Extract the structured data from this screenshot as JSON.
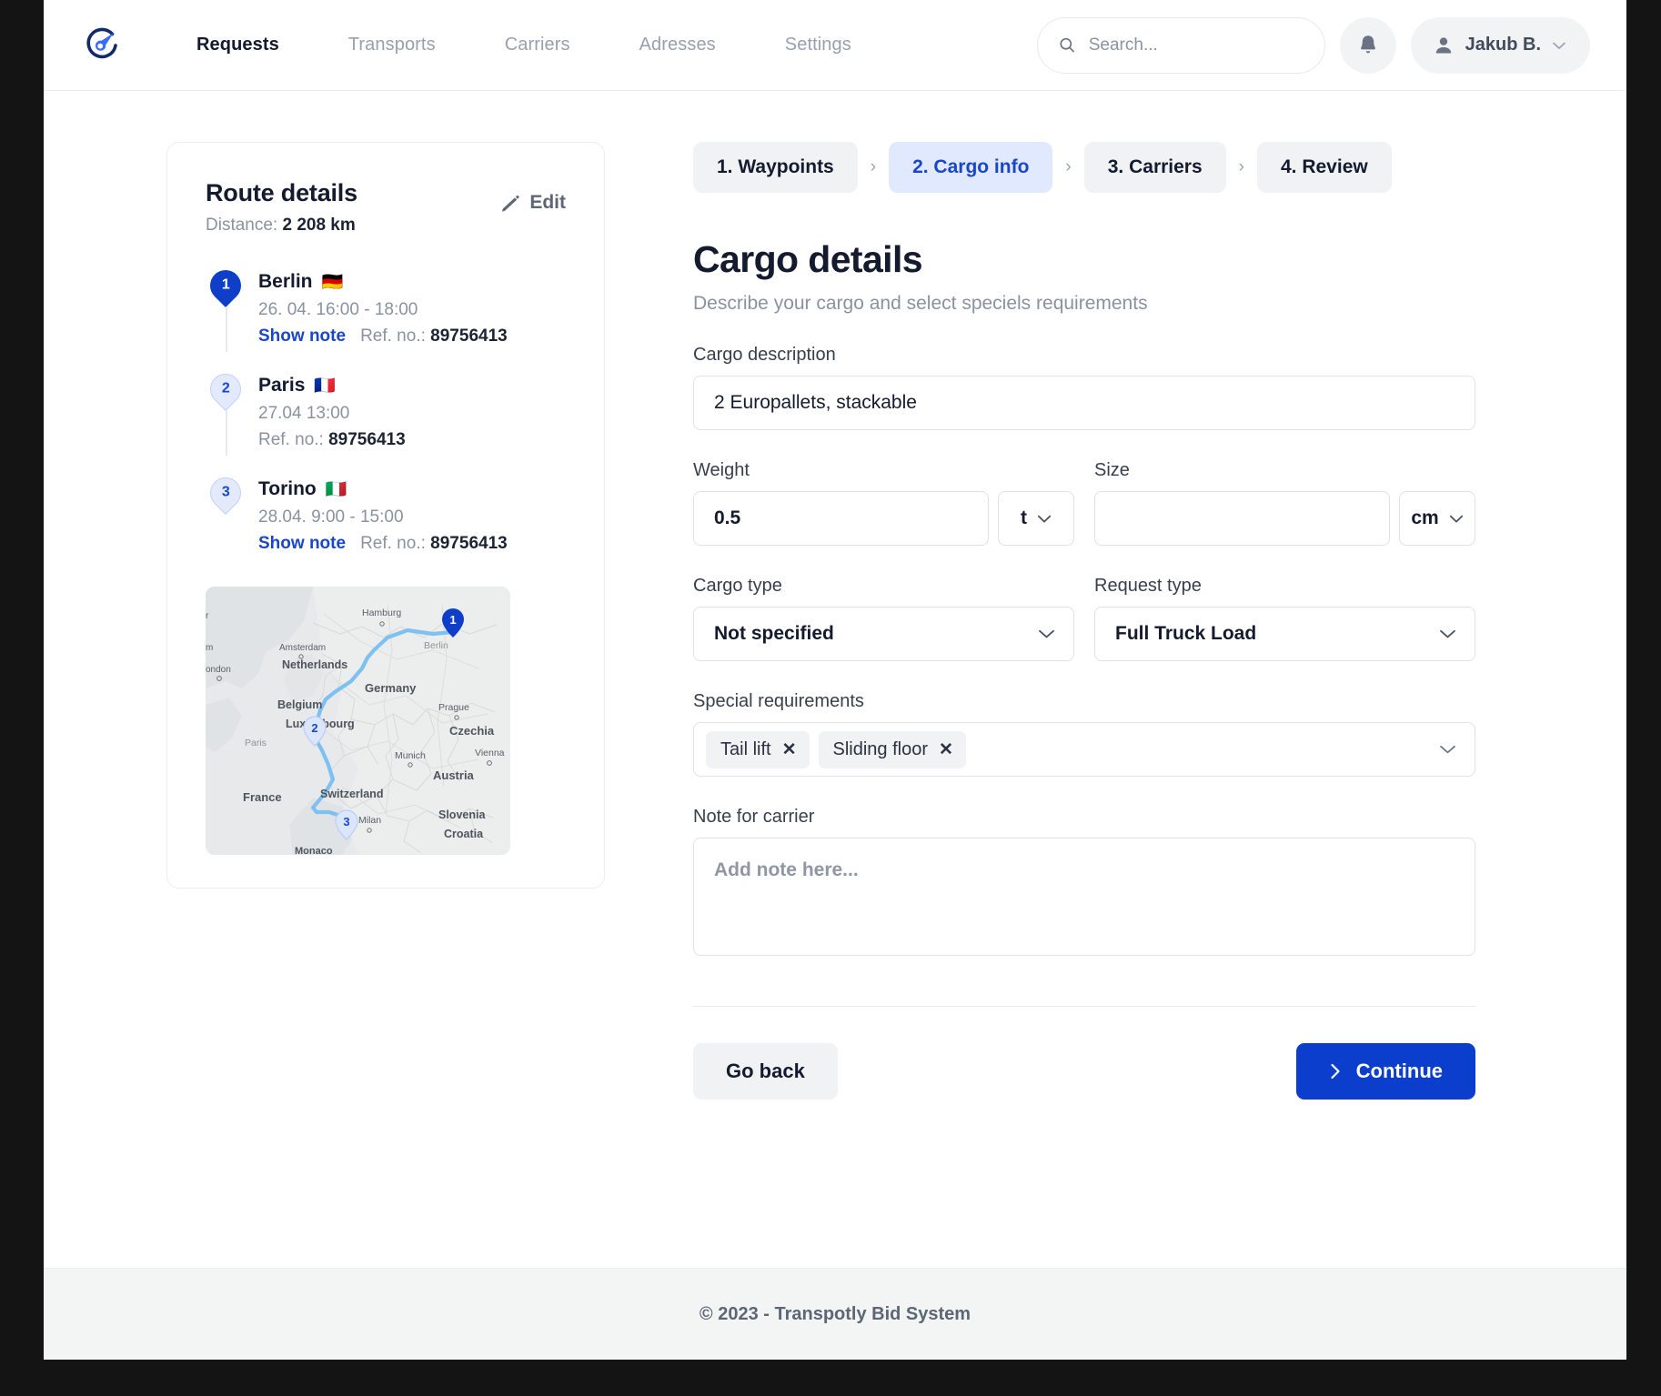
{
  "header": {
    "logo_icon": "transpotly-logo-icon",
    "nav": [
      {
        "label": "Requests",
        "active": true
      },
      {
        "label": "Transports",
        "active": false
      },
      {
        "label": "Carriers",
        "active": false
      },
      {
        "label": "Adresses",
        "active": false
      },
      {
        "label": "Settings",
        "active": false
      }
    ],
    "search": {
      "placeholder": "Search...",
      "value": "",
      "icon": "search-icon"
    },
    "notifications_icon": "bell-icon",
    "user": {
      "name": "Jakub B.",
      "avatar_icon": "person-icon",
      "caret": "▾"
    }
  },
  "route_card": {
    "title": "Route details",
    "distance_label": "Distance:",
    "distance_value": "2 208 km",
    "edit_label": "Edit",
    "edit_icon": "pencil-icon",
    "stops": [
      {
        "number": "1",
        "city": "Berlin",
        "flag": "🇩🇪",
        "time": "26. 04. 16:00 - 18:00",
        "show_note": "Show note",
        "ref_label": "Ref. no.:",
        "ref_value": "89756413",
        "style": "filled"
      },
      {
        "number": "2",
        "city": "Paris",
        "flag": "🇫🇷",
        "time": "27.04 13:00",
        "show_note": "",
        "ref_label": "Ref. no.:",
        "ref_value": "89756413",
        "style": "hollow"
      },
      {
        "number": "3",
        "city": "Torino",
        "flag": "🇮🇹",
        "time": "28.04. 9:00 - 15:00",
        "show_note": "Show note",
        "ref_label": "Ref. no.:",
        "ref_value": "89756413",
        "style": "hollow"
      }
    ],
    "map": {
      "marker_labels": [
        "1",
        "2",
        "3"
      ],
      "city_labels": [
        "Hamburg",
        "Amsterdam",
        "London",
        "Prague",
        "Munich",
        "Vienna",
        "Milan",
        "Monaco",
        "Berlin",
        "Paris"
      ],
      "country_labels": [
        "Netherlands",
        "Germany",
        "Belgium",
        "Luxembourg",
        "Czechia",
        "Austria",
        "France",
        "Switzerland",
        "Slovenia",
        "Croatia"
      ],
      "route_color": "#7ec0f0"
    }
  },
  "wizard": {
    "steps": [
      {
        "label": "1. Waypoints",
        "active": false
      },
      {
        "label": "2. Cargo info",
        "active": true
      },
      {
        "label": "3. Carriers",
        "active": false
      },
      {
        "label": "4. Review",
        "active": false
      }
    ],
    "separator": "›"
  },
  "main": {
    "title": "Cargo details",
    "subtitle": "Describe your cargo and select speciels requirements",
    "cargo_description": {
      "label": "Cargo description",
      "value": "2 Europallets, stackable",
      "placeholder": ""
    },
    "weight": {
      "label": "Weight",
      "value": "0.5",
      "placeholder": "",
      "unit": "t"
    },
    "size": {
      "label": "Size",
      "value": "",
      "placeholder": "",
      "unit": "cm"
    },
    "cargo_type": {
      "label": "Cargo type",
      "value": "Not specified"
    },
    "request_type": {
      "label": "Request type",
      "value": "Full Truck Load"
    },
    "special_requirements": {
      "label": "Special requirements",
      "tags": [
        "Tail lift",
        "Sliding floor"
      ],
      "remove_glyph": "✕"
    },
    "note": {
      "label": "Note for carrier",
      "value": "",
      "placeholder": "Add note here..."
    },
    "go_back_label": "Go back",
    "continue_label": "Continue",
    "continue_icon": "chevron-right-icon"
  },
  "footer": {
    "text": "© 2023 - Transpotly Bid System"
  },
  "colors": {
    "primary": "#0b3ecc",
    "primary_light": "#e1e9fe",
    "link": "#1a46cc",
    "text": "#141b2e",
    "muted": "#8a929f",
    "surface": "#f1f2f4"
  }
}
